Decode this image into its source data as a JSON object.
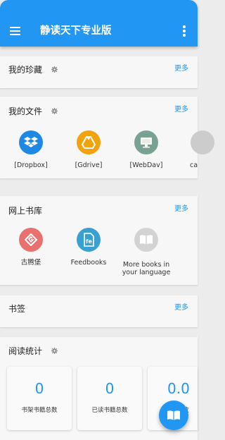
{
  "app_bar": {
    "title": "静读天下专业版",
    "menu_icon": "menu-icon",
    "overflow_icon": "more-vert-icon",
    "color": "#2196f3"
  },
  "sections": {
    "favorites": {
      "title": "我的珍藏",
      "more": "更多"
    },
    "files": {
      "title": "我的文件",
      "more": "更多",
      "items": [
        {
          "label": "[Dropbox]",
          "icon": "dropbox-icon",
          "color": "#1e88e5"
        },
        {
          "label": "[Gdrive]",
          "icon": "google-drive-icon",
          "color": "#f2a20c"
        },
        {
          "label": "[WebDav]",
          "icon": "computer-icon",
          "color": "#78a392"
        },
        {
          "label": "ca",
          "icon": "generic-icon",
          "color": "#cccccc"
        }
      ]
    },
    "online_library": {
      "title": "网上书库",
      "more": "更多",
      "items": [
        {
          "label": "古腾堡",
          "icon": "gutenberg-icon",
          "color": "#e8706e"
        },
        {
          "label": "Feedbooks",
          "icon": "feedbooks-icon",
          "color": "#3aa0d0"
        },
        {
          "label_line1": "More books in",
          "label_line2": "your language",
          "icon": "open-book-icon",
          "color": "#d3d3d3"
        }
      ]
    },
    "bookmarks": {
      "title": "书签",
      "more": "更多"
    },
    "stats": {
      "title": "阅读统计",
      "cards": [
        {
          "value": "0",
          "label": "书架书籍总数"
        },
        {
          "value": "0",
          "label": "已读书籍总数"
        },
        {
          "value": "0.0",
          "label": "数"
        }
      ]
    }
  },
  "fab": {
    "icon": "book-icon"
  }
}
